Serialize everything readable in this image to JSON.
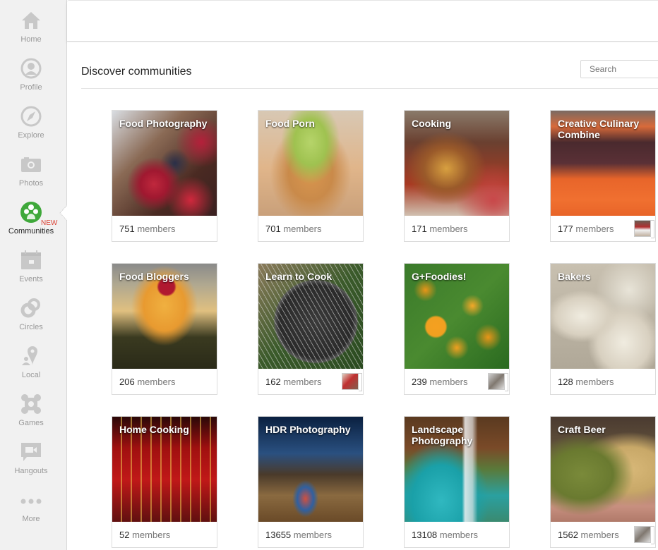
{
  "sidebar": {
    "items": [
      {
        "label": "Home",
        "icon": "home-icon"
      },
      {
        "label": "Profile",
        "icon": "profile-icon"
      },
      {
        "label": "Explore",
        "icon": "compass-icon"
      },
      {
        "label": "Photos",
        "icon": "camera-icon"
      },
      {
        "label": "Communities",
        "icon": "communities-icon",
        "active": true,
        "badge": "NEW"
      },
      {
        "label": "Events",
        "icon": "calendar-icon"
      },
      {
        "label": "Circles",
        "icon": "circles-icon"
      },
      {
        "label": "Local",
        "icon": "map-pin-icon"
      },
      {
        "label": "Games",
        "icon": "games-icon"
      },
      {
        "label": "Hangouts",
        "icon": "video-chat-icon"
      },
      {
        "label": "More",
        "icon": "more-dots-icon"
      }
    ],
    "new_badge": "NEW"
  },
  "colors": {
    "accent_green": "#3ea83a",
    "badge_red": "#db4437",
    "icon_gray": "#c8c8c8"
  },
  "main": {
    "title": "Discover communities",
    "search_placeholder": "Search",
    "members_label": "members",
    "communities": [
      {
        "name": "Food Photography",
        "members": "751",
        "has_owner_avatar": false
      },
      {
        "name": "Food Porn",
        "members": "701",
        "has_owner_avatar": false
      },
      {
        "name": "Cooking",
        "members": "171",
        "has_owner_avatar": false
      },
      {
        "name": "Creative Culinary Combine",
        "members": "177",
        "has_owner_avatar": true
      },
      {
        "name": "Food Bloggers",
        "members": "206",
        "has_owner_avatar": false
      },
      {
        "name": "Learn to Cook",
        "members": "162",
        "has_owner_avatar": true
      },
      {
        "name": "G+Foodies!",
        "members": "239",
        "has_owner_avatar": true
      },
      {
        "name": "Bakers",
        "members": "128",
        "has_owner_avatar": false
      },
      {
        "name": "Home Cooking",
        "members": "52",
        "has_owner_avatar": false
      },
      {
        "name": "HDR Photography",
        "members": "13655",
        "has_owner_avatar": false
      },
      {
        "name": "Landscape Photography",
        "members": "13108",
        "has_owner_avatar": false
      },
      {
        "name": "Craft Beer",
        "members": "1562",
        "has_owner_avatar": true
      }
    ]
  }
}
